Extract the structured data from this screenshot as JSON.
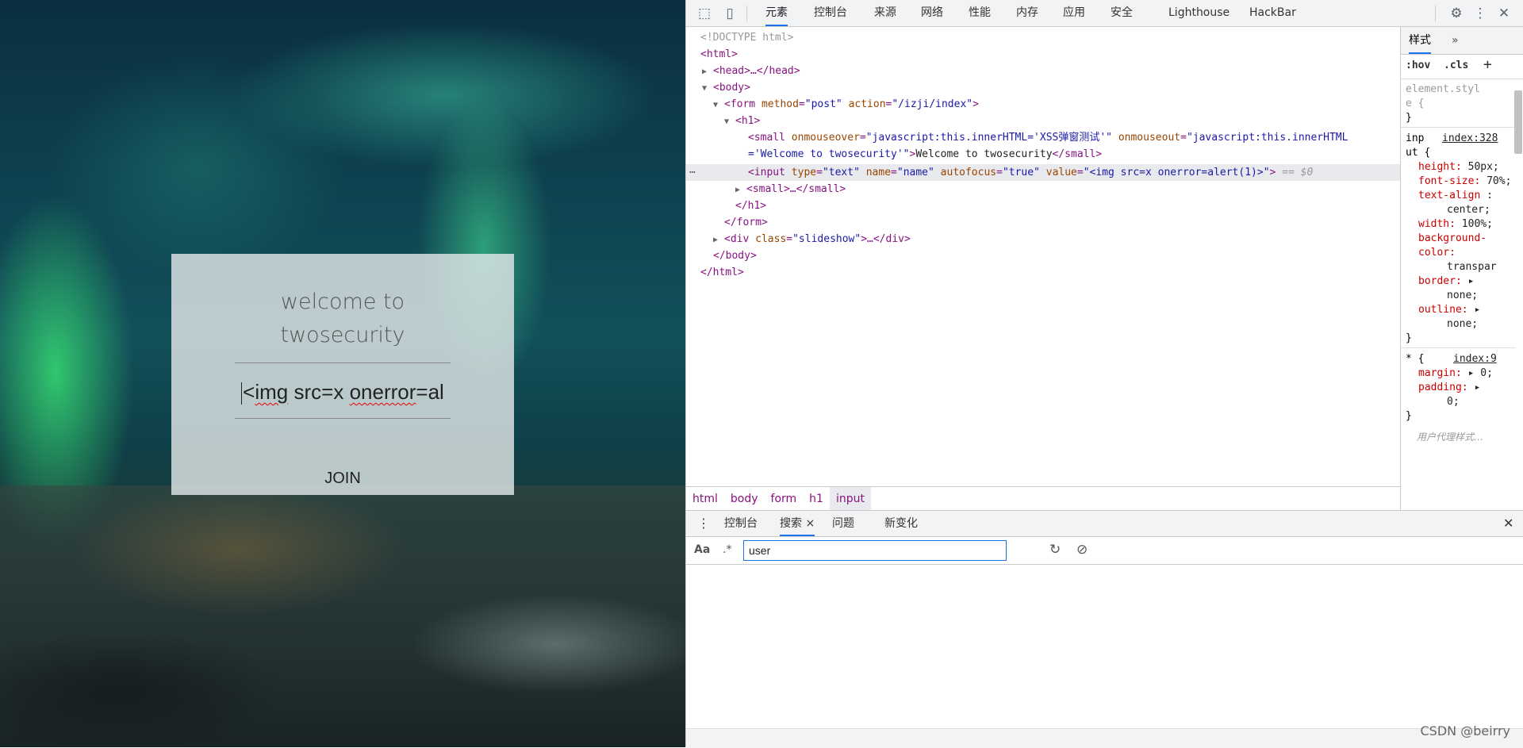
{
  "page": {
    "title_line1": "welcome to",
    "title_line2": "twosecurity",
    "input_value_start": "<",
    "input_value_word1": "img",
    "input_value_mid": " src=x ",
    "input_value_word2": "onerror",
    "input_value_end": "=al",
    "join_label": "JOIN"
  },
  "devtools": {
    "tabs": [
      "元素",
      "控制台",
      "来源",
      "网络",
      "性能",
      "内存",
      "应用",
      "安全",
      "Lighthouse",
      "HackBar"
    ],
    "icons": [
      "inspect-icon",
      "device-toggle-icon",
      "gear-icon",
      "more-vert-icon",
      "close-icon"
    ],
    "dom": {
      "doctype": "<!DOCTYPE html>",
      "html_open": "<html>",
      "head": "<head>…</head>",
      "body_open": "<body>",
      "form_tag": "form",
      "form_attr1": "method",
      "form_val1": "\"post\"",
      "form_attr2": "action",
      "form_val2": "\"/izji/index\"",
      "h1_open": "<h1>",
      "small_tag": "small",
      "small_attr1": "onmouseover",
      "small_val1": "\"javascript:this.innerHTML='XSS弹窗测试'\"",
      "small_attr2": "onmouseout",
      "small_val2a": "\"javascript:this.innerHTML",
      "small_val2b": "='Welcome to twosecurity'\"",
      "small_text": "Welcome to twosecurity",
      "small_close": "</small>",
      "input_tag": "input",
      "input_attr1": "type",
      "input_val1": "\"text\"",
      "input_attr2": "name",
      "input_val2": "\"name\"",
      "input_attr3": "autofocus",
      "input_val3": "\"true\"",
      "input_attr4": "value",
      "input_val4": "\"<img src=x onerror=alert(1)>\"",
      "input_suffix": "== $0",
      "small2": "<small>…</small>",
      "h1_close": "</h1>",
      "form_close": "</form>",
      "div_tag": "div",
      "div_attr": "class",
      "div_val": "\"slideshow\"",
      "div_rest": ">…</div>",
      "body_close": "</body>",
      "html_close": "</html>"
    },
    "breadcrumb": [
      "html",
      "body",
      "form",
      "h1",
      "input"
    ],
    "styles": {
      "tab_label": "样式",
      "more": "»",
      "hov": ":hov",
      "cls": ".cls",
      "plus": "+",
      "element_style_a": "element.styl",
      "element_style_b": "e {",
      "close_brace": "}",
      "rule1_sel_a": "inp",
      "rule1_link": "index:328",
      "rule1_sel_b": "ut {",
      "props": [
        {
          "name": "height:",
          "value": "50px;"
        },
        {
          "name": "font-size:",
          "value": "70%;"
        },
        {
          "name": "text-align",
          "value": ":"
        },
        {
          "name": "",
          "value": "center;"
        },
        {
          "name": "width:",
          "value": "100%;"
        },
        {
          "name": "background-",
          "value": ""
        },
        {
          "name": "color:",
          "value": ""
        },
        {
          "name": "",
          "value": "transpar"
        },
        {
          "name": "border:",
          "value": "▸"
        },
        {
          "name": "",
          "value": "none;"
        },
        {
          "name": "outline:",
          "value": "▸"
        },
        {
          "name": "",
          "value": "none;"
        }
      ],
      "rule2_sel": "* {",
      "rule2_link": "index:9",
      "rule2_props": [
        {
          "name": "margin:",
          "value": "▸ 0;"
        },
        {
          "name": "padding:",
          "value": "▸"
        },
        {
          "name": "",
          "value": "0;"
        }
      ],
      "ua_styles": "用户代理样式…"
    },
    "drawer": {
      "tabs": [
        "控制台",
        "搜索",
        "问题",
        "新变化"
      ],
      "close_x": "×",
      "aa": "Aa",
      "regex": ".*",
      "search_value": "user"
    }
  },
  "watermark": "CSDN @beirry"
}
